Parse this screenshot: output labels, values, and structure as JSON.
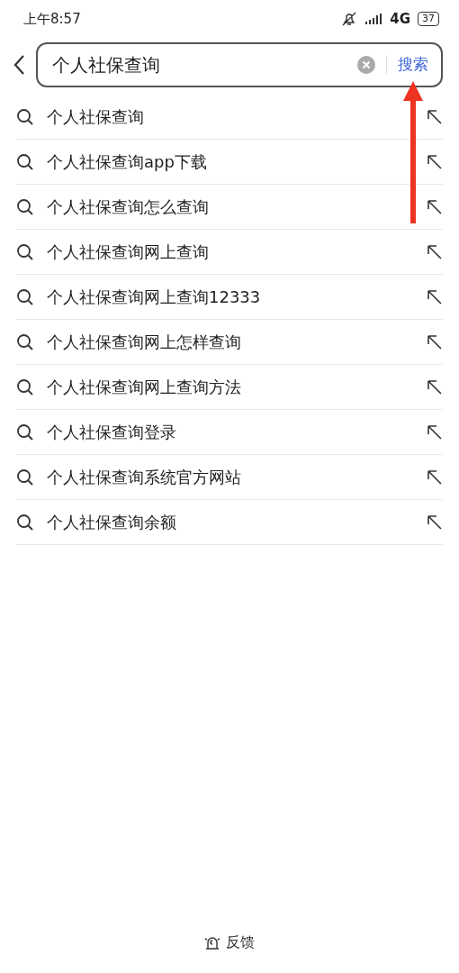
{
  "status_bar": {
    "time": "上午8:57",
    "network": "4G",
    "battery": "37"
  },
  "search": {
    "value": "个人社保查询",
    "button": "搜索"
  },
  "suggestions": [
    {
      "text": "个人社保查询"
    },
    {
      "text": "个人社保查询app下载"
    },
    {
      "text": "个人社保查询怎么查询"
    },
    {
      "text": "个人社保查询网上查询"
    },
    {
      "text": "个人社保查询网上查询12333"
    },
    {
      "text": "个人社保查询网上怎样查询"
    },
    {
      "text": "个人社保查询网上查询方法"
    },
    {
      "text": "个人社保查询登录"
    },
    {
      "text": "个人社保查询系统官方网站"
    },
    {
      "text": "个人社保查询余额"
    }
  ],
  "feedback": "反馈"
}
